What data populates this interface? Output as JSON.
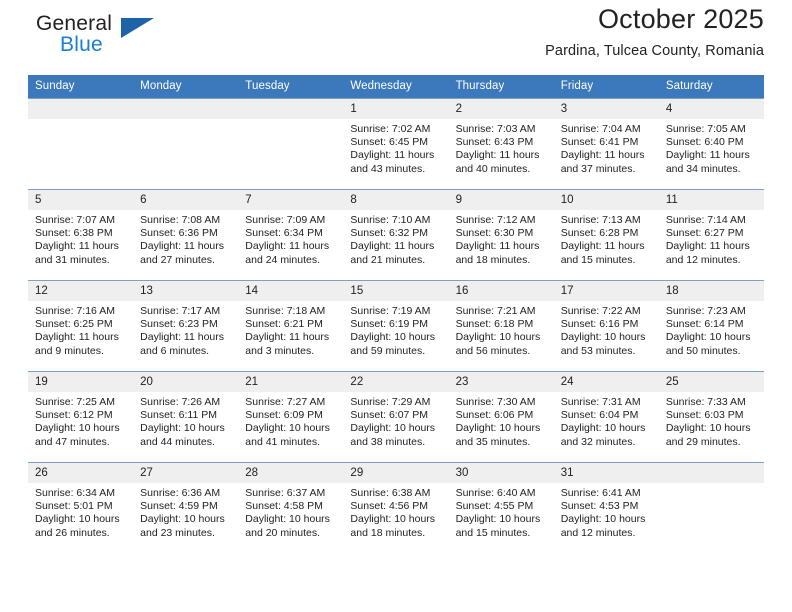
{
  "brand": {
    "name_top": "General",
    "name_bottom": "Blue",
    "triangle_icon": "triangle-icon",
    "accent_blue": "#1a7fd4",
    "triangle_blue": "#1e63a8"
  },
  "header": {
    "title": "October 2025",
    "subtitle": "Pardina, Tulcea County, Romania"
  },
  "calendar": {
    "header_bg": "#3b78bc",
    "header_text_color": "#ffffff",
    "daynum_bg": "#efefef",
    "weekday_headers": [
      "Sunday",
      "Monday",
      "Tuesday",
      "Wednesday",
      "Thursday",
      "Friday",
      "Saturday"
    ],
    "weeks": [
      [
        {
          "day": "",
          "lines": []
        },
        {
          "day": "",
          "lines": []
        },
        {
          "day": "",
          "lines": []
        },
        {
          "day": "1",
          "lines": [
            "Sunrise: 7:02 AM",
            "Sunset: 6:45 PM",
            "Daylight: 11 hours",
            "and 43 minutes."
          ]
        },
        {
          "day": "2",
          "lines": [
            "Sunrise: 7:03 AM",
            "Sunset: 6:43 PM",
            "Daylight: 11 hours",
            "and 40 minutes."
          ]
        },
        {
          "day": "3",
          "lines": [
            "Sunrise: 7:04 AM",
            "Sunset: 6:41 PM",
            "Daylight: 11 hours",
            "and 37 minutes."
          ]
        },
        {
          "day": "4",
          "lines": [
            "Sunrise: 7:05 AM",
            "Sunset: 6:40 PM",
            "Daylight: 11 hours",
            "and 34 minutes."
          ]
        }
      ],
      [
        {
          "day": "5",
          "lines": [
            "Sunrise: 7:07 AM",
            "Sunset: 6:38 PM",
            "Daylight: 11 hours",
            "and 31 minutes."
          ]
        },
        {
          "day": "6",
          "lines": [
            "Sunrise: 7:08 AM",
            "Sunset: 6:36 PM",
            "Daylight: 11 hours",
            "and 27 minutes."
          ]
        },
        {
          "day": "7",
          "lines": [
            "Sunrise: 7:09 AM",
            "Sunset: 6:34 PM",
            "Daylight: 11 hours",
            "and 24 minutes."
          ]
        },
        {
          "day": "8",
          "lines": [
            "Sunrise: 7:10 AM",
            "Sunset: 6:32 PM",
            "Daylight: 11 hours",
            "and 21 minutes."
          ]
        },
        {
          "day": "9",
          "lines": [
            "Sunrise: 7:12 AM",
            "Sunset: 6:30 PM",
            "Daylight: 11 hours",
            "and 18 minutes."
          ]
        },
        {
          "day": "10",
          "lines": [
            "Sunrise: 7:13 AM",
            "Sunset: 6:28 PM",
            "Daylight: 11 hours",
            "and 15 minutes."
          ]
        },
        {
          "day": "11",
          "lines": [
            "Sunrise: 7:14 AM",
            "Sunset: 6:27 PM",
            "Daylight: 11 hours",
            "and 12 minutes."
          ]
        }
      ],
      [
        {
          "day": "12",
          "lines": [
            "Sunrise: 7:16 AM",
            "Sunset: 6:25 PM",
            "Daylight: 11 hours",
            "and 9 minutes."
          ]
        },
        {
          "day": "13",
          "lines": [
            "Sunrise: 7:17 AM",
            "Sunset: 6:23 PM",
            "Daylight: 11 hours",
            "and 6 minutes."
          ]
        },
        {
          "day": "14",
          "lines": [
            "Sunrise: 7:18 AM",
            "Sunset: 6:21 PM",
            "Daylight: 11 hours",
            "and 3 minutes."
          ]
        },
        {
          "day": "15",
          "lines": [
            "Sunrise: 7:19 AM",
            "Sunset: 6:19 PM",
            "Daylight: 10 hours",
            "and 59 minutes."
          ]
        },
        {
          "day": "16",
          "lines": [
            "Sunrise: 7:21 AM",
            "Sunset: 6:18 PM",
            "Daylight: 10 hours",
            "and 56 minutes."
          ]
        },
        {
          "day": "17",
          "lines": [
            "Sunrise: 7:22 AM",
            "Sunset: 6:16 PM",
            "Daylight: 10 hours",
            "and 53 minutes."
          ]
        },
        {
          "day": "18",
          "lines": [
            "Sunrise: 7:23 AM",
            "Sunset: 6:14 PM",
            "Daylight: 10 hours",
            "and 50 minutes."
          ]
        }
      ],
      [
        {
          "day": "19",
          "lines": [
            "Sunrise: 7:25 AM",
            "Sunset: 6:12 PM",
            "Daylight: 10 hours",
            "and 47 minutes."
          ]
        },
        {
          "day": "20",
          "lines": [
            "Sunrise: 7:26 AM",
            "Sunset: 6:11 PM",
            "Daylight: 10 hours",
            "and 44 minutes."
          ]
        },
        {
          "day": "21",
          "lines": [
            "Sunrise: 7:27 AM",
            "Sunset: 6:09 PM",
            "Daylight: 10 hours",
            "and 41 minutes."
          ]
        },
        {
          "day": "22",
          "lines": [
            "Sunrise: 7:29 AM",
            "Sunset: 6:07 PM",
            "Daylight: 10 hours",
            "and 38 minutes."
          ]
        },
        {
          "day": "23",
          "lines": [
            "Sunrise: 7:30 AM",
            "Sunset: 6:06 PM",
            "Daylight: 10 hours",
            "and 35 minutes."
          ]
        },
        {
          "day": "24",
          "lines": [
            "Sunrise: 7:31 AM",
            "Sunset: 6:04 PM",
            "Daylight: 10 hours",
            "and 32 minutes."
          ]
        },
        {
          "day": "25",
          "lines": [
            "Sunrise: 7:33 AM",
            "Sunset: 6:03 PM",
            "Daylight: 10 hours",
            "and 29 minutes."
          ]
        }
      ],
      [
        {
          "day": "26",
          "lines": [
            "Sunrise: 6:34 AM",
            "Sunset: 5:01 PM",
            "Daylight: 10 hours",
            "and 26 minutes."
          ]
        },
        {
          "day": "27",
          "lines": [
            "Sunrise: 6:36 AM",
            "Sunset: 4:59 PM",
            "Daylight: 10 hours",
            "and 23 minutes."
          ]
        },
        {
          "day": "28",
          "lines": [
            "Sunrise: 6:37 AM",
            "Sunset: 4:58 PM",
            "Daylight: 10 hours",
            "and 20 minutes."
          ]
        },
        {
          "day": "29",
          "lines": [
            "Sunrise: 6:38 AM",
            "Sunset: 4:56 PM",
            "Daylight: 10 hours",
            "and 18 minutes."
          ]
        },
        {
          "day": "30",
          "lines": [
            "Sunrise: 6:40 AM",
            "Sunset: 4:55 PM",
            "Daylight: 10 hours",
            "and 15 minutes."
          ]
        },
        {
          "day": "31",
          "lines": [
            "Sunrise: 6:41 AM",
            "Sunset: 4:53 PM",
            "Daylight: 10 hours",
            "and 12 minutes."
          ]
        },
        {
          "day": "",
          "lines": []
        }
      ]
    ]
  }
}
